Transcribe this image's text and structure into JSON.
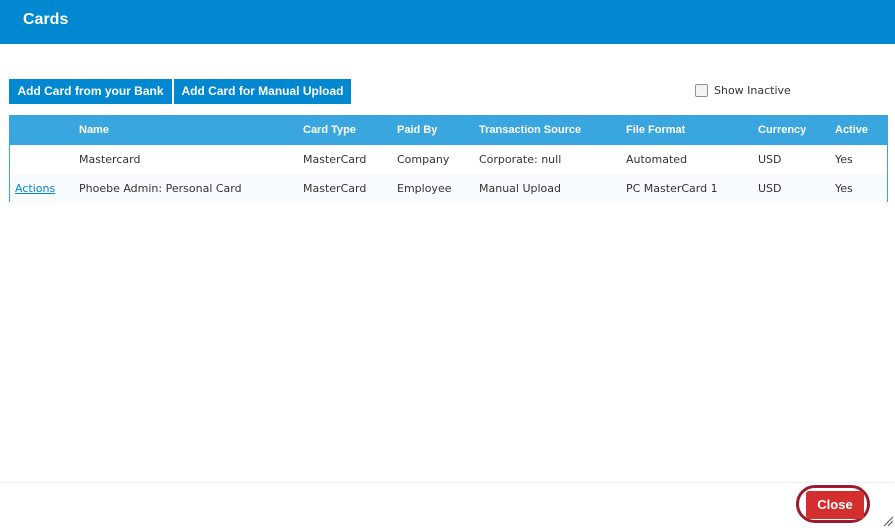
{
  "dialog": {
    "title": "Cards"
  },
  "toolbar": {
    "add_bank_label": "Add Card from your Bank",
    "add_manual_label": "Add Card for Manual Upload",
    "show_inactive_label": "Show Inactive",
    "show_inactive_checked": false
  },
  "table": {
    "columns": {
      "actions": "",
      "name": "Name",
      "card_type": "Card Type",
      "paid_by": "Paid By",
      "transaction_source": "Transaction Source",
      "file_format": "File Format",
      "currency": "Currency",
      "active": "Active"
    },
    "rows": [
      {
        "actions": "",
        "name": "Mastercard",
        "card_type": "MasterCard",
        "paid_by": "Company",
        "transaction_source": "Corporate: null",
        "file_format": "Automated",
        "currency": "USD",
        "active": "Yes"
      },
      {
        "actions": "Actions",
        "name": "Phoebe Admin: Personal Card",
        "card_type": "MasterCard",
        "paid_by": "Employee",
        "transaction_source": "Manual Upload",
        "file_format": "PC MasterCard 1",
        "currency": "USD",
        "active": "Yes"
      }
    ]
  },
  "footer": {
    "close_label": "Close"
  },
  "colors": {
    "header": "#0288d1",
    "table_header": "#3aa6e0",
    "close_button": "#d32f2f",
    "highlight_ring": "#9b1b30"
  },
  "icons": {
    "resize": "resize-grip-icon"
  }
}
